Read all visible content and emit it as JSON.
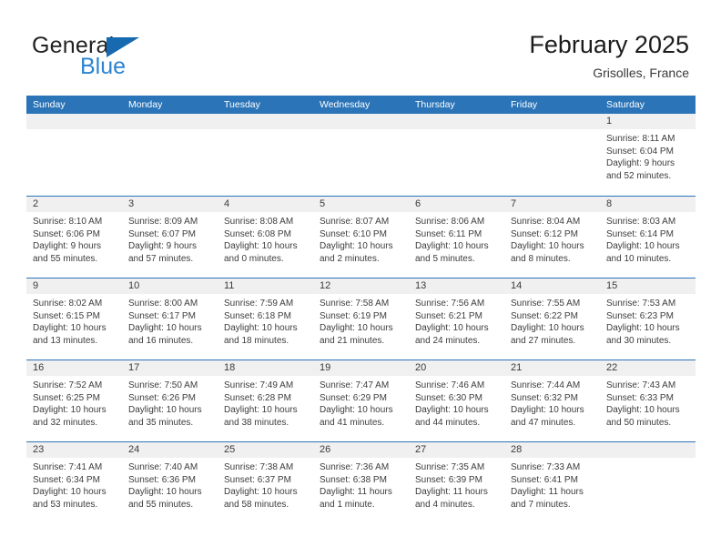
{
  "brand": {
    "name_part1": "General",
    "name_part2": "Blue",
    "triangle_color": "#1769b0",
    "blue_text_color": "#2a84d2"
  },
  "header": {
    "title": "February 2025",
    "subtitle": "Grisolles, France",
    "accent_color": "#2b74b8"
  },
  "weekdays": [
    "Sunday",
    "Monday",
    "Tuesday",
    "Wednesday",
    "Thursday",
    "Friday",
    "Saturday"
  ],
  "weeks": [
    [
      {
        "day": "",
        "sunrise": "",
        "sunset": "",
        "daylight1": "",
        "daylight2": "",
        "empty": true
      },
      {
        "day": "",
        "sunrise": "",
        "sunset": "",
        "daylight1": "",
        "daylight2": "",
        "empty": true
      },
      {
        "day": "",
        "sunrise": "",
        "sunset": "",
        "daylight1": "",
        "daylight2": "",
        "empty": true
      },
      {
        "day": "",
        "sunrise": "",
        "sunset": "",
        "daylight1": "",
        "daylight2": "",
        "empty": true
      },
      {
        "day": "",
        "sunrise": "",
        "sunset": "",
        "daylight1": "",
        "daylight2": "",
        "empty": true
      },
      {
        "day": "",
        "sunrise": "",
        "sunset": "",
        "daylight1": "",
        "daylight2": "",
        "empty": true
      },
      {
        "day": "1",
        "sunrise": "Sunrise: 8:11 AM",
        "sunset": "Sunset: 6:04 PM",
        "daylight1": "Daylight: 9 hours",
        "daylight2": "and 52 minutes.",
        "empty": false
      }
    ],
    [
      {
        "day": "2",
        "sunrise": "Sunrise: 8:10 AM",
        "sunset": "Sunset: 6:06 PM",
        "daylight1": "Daylight: 9 hours",
        "daylight2": "and 55 minutes.",
        "empty": false
      },
      {
        "day": "3",
        "sunrise": "Sunrise: 8:09 AM",
        "sunset": "Sunset: 6:07 PM",
        "daylight1": "Daylight: 9 hours",
        "daylight2": "and 57 minutes.",
        "empty": false
      },
      {
        "day": "4",
        "sunrise": "Sunrise: 8:08 AM",
        "sunset": "Sunset: 6:08 PM",
        "daylight1": "Daylight: 10 hours",
        "daylight2": "and 0 minutes.",
        "empty": false
      },
      {
        "day": "5",
        "sunrise": "Sunrise: 8:07 AM",
        "sunset": "Sunset: 6:10 PM",
        "daylight1": "Daylight: 10 hours",
        "daylight2": "and 2 minutes.",
        "empty": false
      },
      {
        "day": "6",
        "sunrise": "Sunrise: 8:06 AM",
        "sunset": "Sunset: 6:11 PM",
        "daylight1": "Daylight: 10 hours",
        "daylight2": "and 5 minutes.",
        "empty": false
      },
      {
        "day": "7",
        "sunrise": "Sunrise: 8:04 AM",
        "sunset": "Sunset: 6:12 PM",
        "daylight1": "Daylight: 10 hours",
        "daylight2": "and 8 minutes.",
        "empty": false
      },
      {
        "day": "8",
        "sunrise": "Sunrise: 8:03 AM",
        "sunset": "Sunset: 6:14 PM",
        "daylight1": "Daylight: 10 hours",
        "daylight2": "and 10 minutes.",
        "empty": false
      }
    ],
    [
      {
        "day": "9",
        "sunrise": "Sunrise: 8:02 AM",
        "sunset": "Sunset: 6:15 PM",
        "daylight1": "Daylight: 10 hours",
        "daylight2": "and 13 minutes.",
        "empty": false
      },
      {
        "day": "10",
        "sunrise": "Sunrise: 8:00 AM",
        "sunset": "Sunset: 6:17 PM",
        "daylight1": "Daylight: 10 hours",
        "daylight2": "and 16 minutes.",
        "empty": false
      },
      {
        "day": "11",
        "sunrise": "Sunrise: 7:59 AM",
        "sunset": "Sunset: 6:18 PM",
        "daylight1": "Daylight: 10 hours",
        "daylight2": "and 18 minutes.",
        "empty": false
      },
      {
        "day": "12",
        "sunrise": "Sunrise: 7:58 AM",
        "sunset": "Sunset: 6:19 PM",
        "daylight1": "Daylight: 10 hours",
        "daylight2": "and 21 minutes.",
        "empty": false
      },
      {
        "day": "13",
        "sunrise": "Sunrise: 7:56 AM",
        "sunset": "Sunset: 6:21 PM",
        "daylight1": "Daylight: 10 hours",
        "daylight2": "and 24 minutes.",
        "empty": false
      },
      {
        "day": "14",
        "sunrise": "Sunrise: 7:55 AM",
        "sunset": "Sunset: 6:22 PM",
        "daylight1": "Daylight: 10 hours",
        "daylight2": "and 27 minutes.",
        "empty": false
      },
      {
        "day": "15",
        "sunrise": "Sunrise: 7:53 AM",
        "sunset": "Sunset: 6:23 PM",
        "daylight1": "Daylight: 10 hours",
        "daylight2": "and 30 minutes.",
        "empty": false
      }
    ],
    [
      {
        "day": "16",
        "sunrise": "Sunrise: 7:52 AM",
        "sunset": "Sunset: 6:25 PM",
        "daylight1": "Daylight: 10 hours",
        "daylight2": "and 32 minutes.",
        "empty": false
      },
      {
        "day": "17",
        "sunrise": "Sunrise: 7:50 AM",
        "sunset": "Sunset: 6:26 PM",
        "daylight1": "Daylight: 10 hours",
        "daylight2": "and 35 minutes.",
        "empty": false
      },
      {
        "day": "18",
        "sunrise": "Sunrise: 7:49 AM",
        "sunset": "Sunset: 6:28 PM",
        "daylight1": "Daylight: 10 hours",
        "daylight2": "and 38 minutes.",
        "empty": false
      },
      {
        "day": "19",
        "sunrise": "Sunrise: 7:47 AM",
        "sunset": "Sunset: 6:29 PM",
        "daylight1": "Daylight: 10 hours",
        "daylight2": "and 41 minutes.",
        "empty": false
      },
      {
        "day": "20",
        "sunrise": "Sunrise: 7:46 AM",
        "sunset": "Sunset: 6:30 PM",
        "daylight1": "Daylight: 10 hours",
        "daylight2": "and 44 minutes.",
        "empty": false
      },
      {
        "day": "21",
        "sunrise": "Sunrise: 7:44 AM",
        "sunset": "Sunset: 6:32 PM",
        "daylight1": "Daylight: 10 hours",
        "daylight2": "and 47 minutes.",
        "empty": false
      },
      {
        "day": "22",
        "sunrise": "Sunrise: 7:43 AM",
        "sunset": "Sunset: 6:33 PM",
        "daylight1": "Daylight: 10 hours",
        "daylight2": "and 50 minutes.",
        "empty": false
      }
    ],
    [
      {
        "day": "23",
        "sunrise": "Sunrise: 7:41 AM",
        "sunset": "Sunset: 6:34 PM",
        "daylight1": "Daylight: 10 hours",
        "daylight2": "and 53 minutes.",
        "empty": false
      },
      {
        "day": "24",
        "sunrise": "Sunrise: 7:40 AM",
        "sunset": "Sunset: 6:36 PM",
        "daylight1": "Daylight: 10 hours",
        "daylight2": "and 55 minutes.",
        "empty": false
      },
      {
        "day": "25",
        "sunrise": "Sunrise: 7:38 AM",
        "sunset": "Sunset: 6:37 PM",
        "daylight1": "Daylight: 10 hours",
        "daylight2": "and 58 minutes.",
        "empty": false
      },
      {
        "day": "26",
        "sunrise": "Sunrise: 7:36 AM",
        "sunset": "Sunset: 6:38 PM",
        "daylight1": "Daylight: 11 hours",
        "daylight2": "and 1 minute.",
        "empty": false
      },
      {
        "day": "27",
        "sunrise": "Sunrise: 7:35 AM",
        "sunset": "Sunset: 6:39 PM",
        "daylight1": "Daylight: 11 hours",
        "daylight2": "and 4 minutes.",
        "empty": false
      },
      {
        "day": "28",
        "sunrise": "Sunrise: 7:33 AM",
        "sunset": "Sunset: 6:41 PM",
        "daylight1": "Daylight: 11 hours",
        "daylight2": "and 7 minutes.",
        "empty": false
      },
      {
        "day": "",
        "sunrise": "",
        "sunset": "",
        "daylight1": "",
        "daylight2": "",
        "empty": true
      }
    ]
  ]
}
